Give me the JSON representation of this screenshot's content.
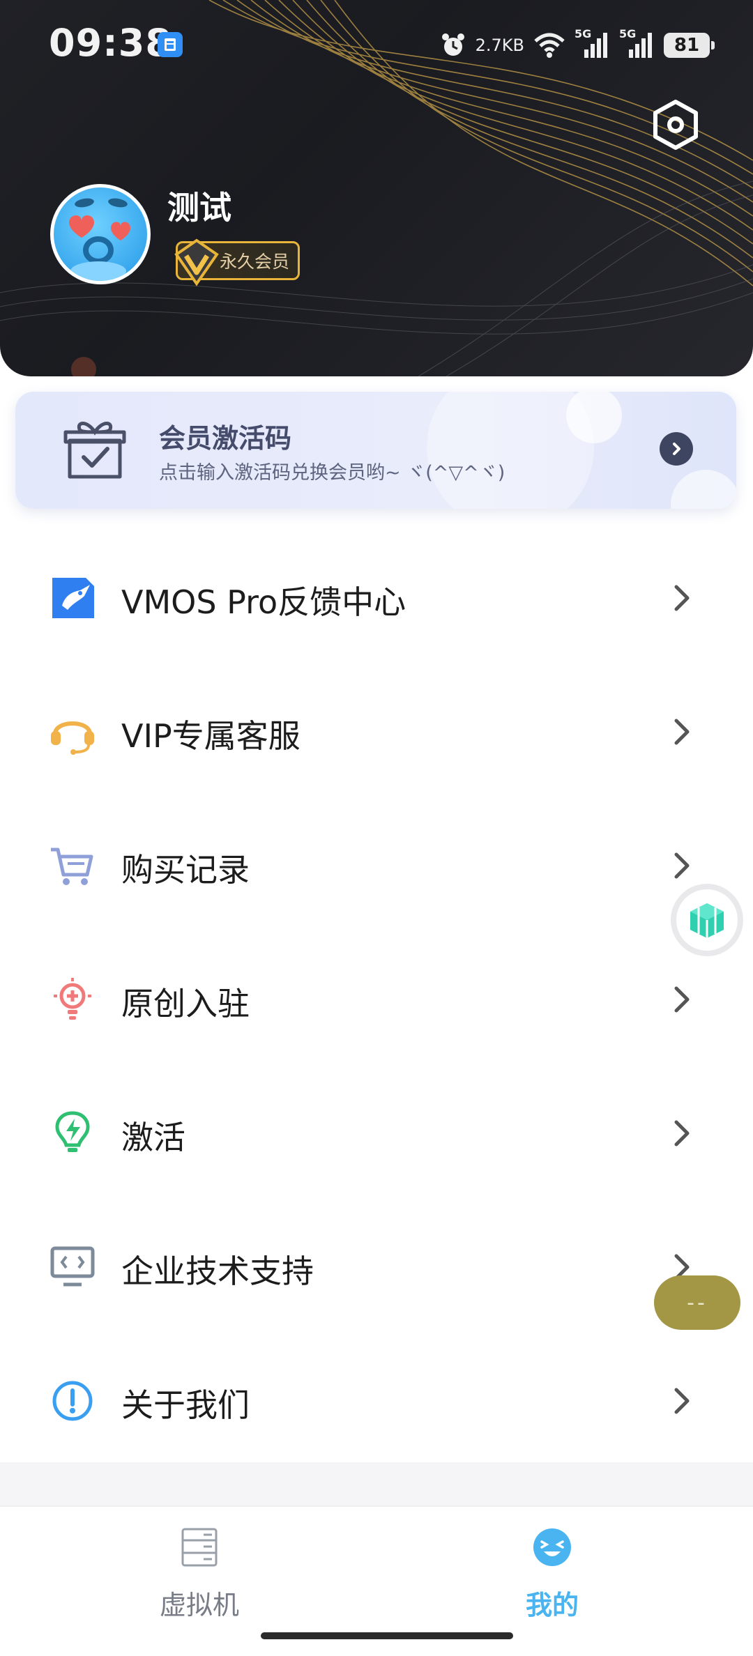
{
  "status_bar": {
    "time": "09:38",
    "net_speed": "2.7KB",
    "signal1_label": "5G",
    "signal2_label": "5G",
    "battery": "81"
  },
  "profile": {
    "username": "测试",
    "member_badge": "永久会员"
  },
  "activation_card": {
    "title": "会员激活码",
    "subtitle": "点击输入激活码兑换会员哟~ ヾ(^▽^ヾ)"
  },
  "menu": {
    "items": [
      {
        "label": "VMOS Pro反馈中心",
        "icon": "vmos-feedback-icon"
      },
      {
        "label": "VIP专属客服",
        "icon": "headset-icon"
      },
      {
        "label": "购买记录",
        "icon": "cart-icon"
      },
      {
        "label": "原创入驻",
        "icon": "lightbulb-plus-icon"
      },
      {
        "label": "激活",
        "icon": "lightning-bulb-icon"
      },
      {
        "label": "企业技术支持",
        "icon": "monitor-code-icon"
      },
      {
        "label": "关于我们",
        "icon": "info-circle-icon"
      }
    ]
  },
  "floating": {
    "pill_text": "--"
  },
  "bottom_nav": {
    "tabs": [
      {
        "label": "虚拟机",
        "active": false
      },
      {
        "label": "我的",
        "active": true
      }
    ]
  },
  "colors": {
    "accent": "#49b4f0",
    "badge_gold": "#e8b53a",
    "header_bg": "#1e1f24"
  }
}
